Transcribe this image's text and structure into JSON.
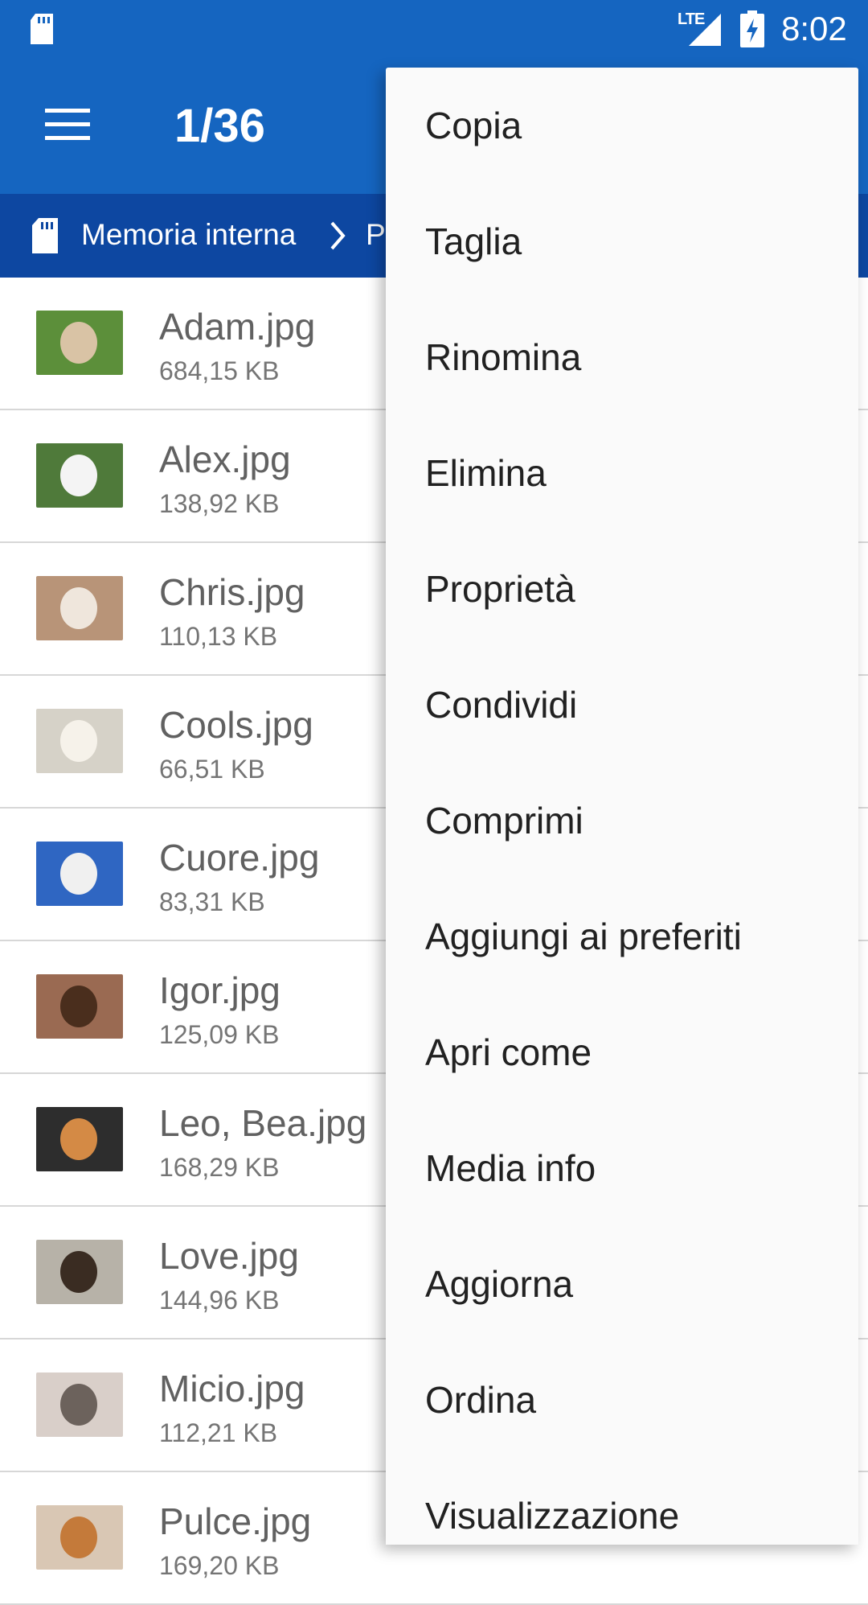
{
  "status_bar": {
    "network": "LTE",
    "time": "8:02",
    "icons": [
      "sd-card-icon",
      "lte-signal-icon",
      "battery-charging-icon"
    ]
  },
  "app_bar": {
    "title": "1/36",
    "menu_icon": "hamburger-menu-icon"
  },
  "breadcrumb": {
    "root": "Memoria interna",
    "current": "P",
    "icons": [
      "sd-card-icon",
      "chevron-right-icon"
    ]
  },
  "files": [
    {
      "name": "Adam.jpg",
      "size": "684,15 KB",
      "thumb_bg": "#5c8f3a",
      "thumb_fg": "#d9c3a5"
    },
    {
      "name": "Alex.jpg",
      "size": "138,92 KB",
      "thumb_bg": "#4f7a3a",
      "thumb_fg": "#f4f4f4"
    },
    {
      "name": "Chris.jpg",
      "size": "110,13 KB",
      "thumb_bg": "#b89478",
      "thumb_fg": "#efe6dc"
    },
    {
      "name": "Cools.jpg",
      "size": "66,51 KB",
      "thumb_bg": "#d6d2c8",
      "thumb_fg": "#f6f2ea"
    },
    {
      "name": "Cuore.jpg",
      "size": "83,31 KB",
      "thumb_bg": "#2f66c2",
      "thumb_fg": "#f0f0f0"
    },
    {
      "name": "Igor.jpg",
      "size": "125,09 KB",
      "thumb_bg": "#9a6a52",
      "thumb_fg": "#4a2e1d"
    },
    {
      "name": "Leo, Bea.jpg",
      "size": "168,29 KB",
      "thumb_bg": "#2d2d2d",
      "thumb_fg": "#d48a45"
    },
    {
      "name": "Love.jpg",
      "size": "144,96 KB",
      "thumb_bg": "#b7b2a8",
      "thumb_fg": "#3a2c22"
    },
    {
      "name": "Micio.jpg",
      "size": "112,21 KB",
      "thumb_bg": "#d9cfc9",
      "thumb_fg": "#6c625c"
    },
    {
      "name": "Pulce.jpg",
      "size": "169,20 KB",
      "thumb_bg": "#d9c7b4",
      "thumb_fg": "#c47a3a"
    }
  ],
  "menu": {
    "items": [
      "Copia",
      "Taglia",
      "Rinomina",
      "Elimina",
      "Proprietà",
      "Condividi",
      "Comprimi",
      "Aggiungi ai preferiti",
      "Apri come",
      "Media info",
      "Aggiorna",
      "Ordina",
      "Visualizzazione"
    ]
  },
  "colors": {
    "app_bar": "#1565c0",
    "breadcrumb_bar": "#0d47a1",
    "menu_background": "#fafafa"
  }
}
